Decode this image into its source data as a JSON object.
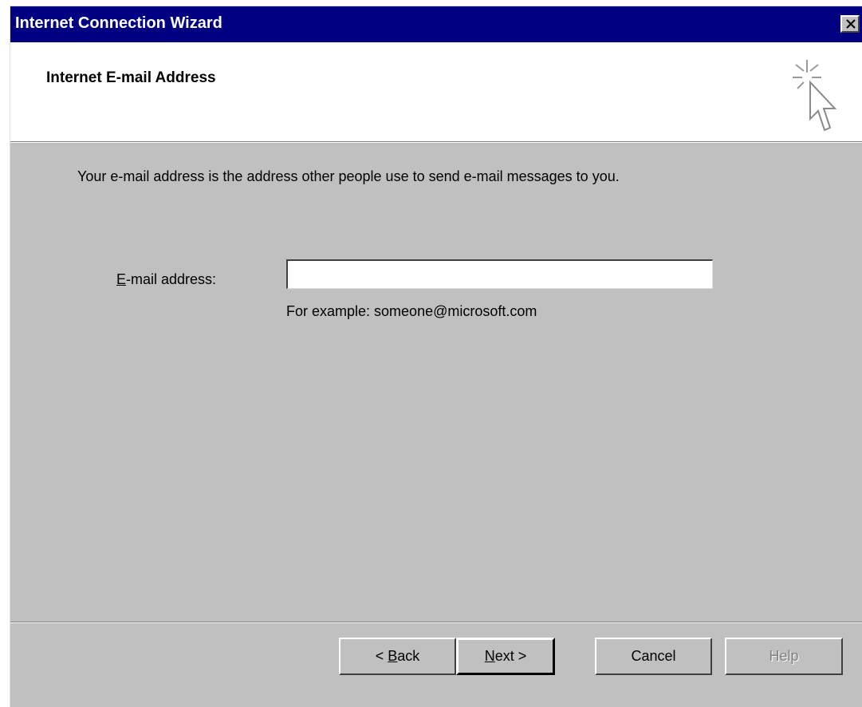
{
  "window": {
    "title": "Internet Connection Wizard",
    "close_glyph": "✕"
  },
  "header": {
    "title": "Internet E-mail Address",
    "icon": "wizard-sparkle-cursor-icon"
  },
  "body": {
    "description": "Your e-mail address is the address other people use to send e-mail messages to you.",
    "email_label_mnemonic": "E",
    "email_label_rest": "-mail address:",
    "email_value": "",
    "example": "For example: someone@microsoft.com"
  },
  "buttons": {
    "back_prefix": "< ",
    "back_mnemonic": "B",
    "back_rest": "ack",
    "next_mnemonic": "N",
    "next_rest": "ext >",
    "cancel": "Cancel",
    "help": "Help"
  },
  "colors": {
    "titlebar": "#000080",
    "face": "#c0c0c0",
    "header": "#ffffff",
    "disabled_text": "#808080"
  }
}
